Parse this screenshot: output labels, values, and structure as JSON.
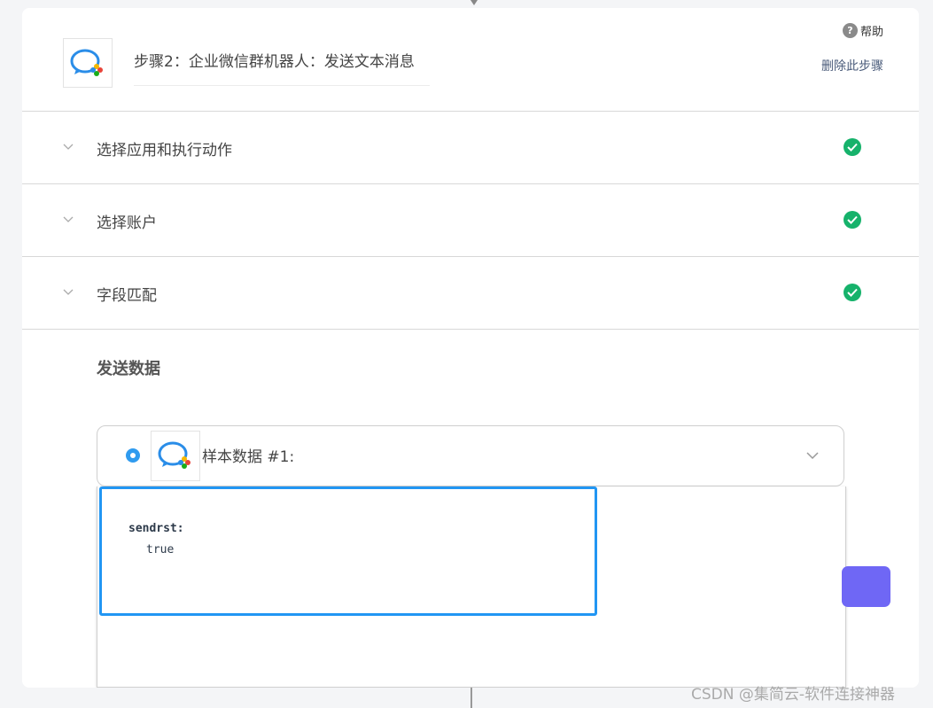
{
  "step": {
    "title": "步骤2：企业微信群机器人：发送文本消息",
    "help_label": "帮助",
    "help_icon": "question-circle-icon",
    "delete_label": "删除此步骤"
  },
  "sections": [
    {
      "label": "选择应用和执行动作",
      "status": "complete"
    },
    {
      "label": "选择账户",
      "status": "complete"
    },
    {
      "label": "字段匹配",
      "status": "complete"
    }
  ],
  "send_data": {
    "title": "发送数据",
    "sample_label": "样本数据 #1:",
    "fields": [
      {
        "key": "sendrst:",
        "value": "true"
      }
    ]
  },
  "watermark": "CSDN @集简云-软件连接神器",
  "colors": {
    "check_green": "#16b26b",
    "highlight_blue": "#2196f3",
    "accent_purple": "#6f67f5",
    "radio_blue": "#2f9bef"
  }
}
